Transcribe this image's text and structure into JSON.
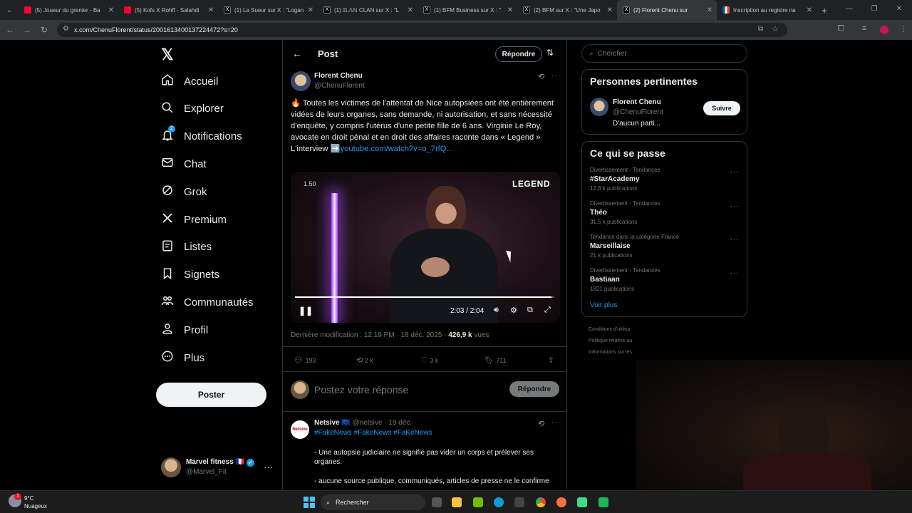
{
  "browser": {
    "tabs": [
      {
        "title": "(5) Joueur du grenier - Ba",
        "favicon": "youtube-icon"
      },
      {
        "title": "(5) Kofs X Rohff - Salahdi",
        "favicon": "youtube-icon"
      },
      {
        "title": "(1) La Sueur sur X : \"Logan",
        "favicon": "x-icon"
      },
      {
        "title": "(1) 𝕀𝕃𝔸ℕ CLAN sur X : \"L",
        "favicon": "x-icon"
      },
      {
        "title": "(1) BFM Business sur X : \"",
        "favicon": "x-icon"
      },
      {
        "title": "(2) BFM sur X : \"Une Japo",
        "favicon": "x-icon"
      },
      {
        "title": "(2) Florent Chenu sur",
        "favicon": "x-icon"
      },
      {
        "title": "Inscription au registre na",
        "favicon": "france-flag-icon"
      }
    ],
    "active_tab_index": 6,
    "url": "x.com/ChenuFlorent/status/2001613400137224472?s=20"
  },
  "nav": {
    "logo": "𝕏",
    "items": [
      {
        "label": "Accueil",
        "icon": "home-icon"
      },
      {
        "label": "Explorer",
        "icon": "search-icon"
      },
      {
        "label": "Notifications",
        "icon": "bell-icon",
        "badge": "2"
      },
      {
        "label": "Chat",
        "icon": "mail-icon"
      },
      {
        "label": "Grok",
        "icon": "grok-icon"
      },
      {
        "label": "Premium",
        "icon": "x-premium-icon"
      },
      {
        "label": "Listes",
        "icon": "list-icon"
      },
      {
        "label": "Signets",
        "icon": "bookmark-icon"
      },
      {
        "label": "Communautés",
        "icon": "communities-icon"
      },
      {
        "label": "Profil",
        "icon": "person-icon"
      },
      {
        "label": "Plus",
        "icon": "more-circle-icon"
      }
    ],
    "post_button": "Poster",
    "account": {
      "name": "Marvel fitness 🇫🇷",
      "handle": "@Marvel_Fit"
    }
  },
  "header": {
    "title": "Post",
    "reply_button": "Répondre"
  },
  "post": {
    "author": "Florent Chenu",
    "handle": "@ChenuFlorent",
    "text": "🔥 Toutes les victimes de l'attentat de Nice autopsiées ont été entièrement vidées de leurs organes, sans demande, ni autorisation, et sans nécessité d'enquête, y compris l'utérus d'une petite fille de 6 ans. Virginie Le Roy, avocate en droit pénal et en droit des affaires raconte dans « Legend »",
    "link_prefix": "L'interview ➡️",
    "link": "youtube.com/watch?v=o_7rfQ...",
    "video": {
      "watermark": "LEGEND",
      "corner_label": "1.50",
      "time": "2:03 / 2:04",
      "progress": 0.99
    },
    "meta": "Dernière modification : 12:19 PM · 18 déc. 2025 ·",
    "views_count": "426,9 k",
    "views_label": "vues",
    "stats": {
      "replies": "193",
      "reposts": "2 k",
      "likes": "3 k",
      "bookmarks": "711"
    },
    "reply_placeholder": "Postez votre réponse",
    "reply_button": "Répondre"
  },
  "reply": {
    "author": "Netsive",
    "flag": "🇪🇺",
    "handle_date": "@netsive · 19 déc.",
    "avatar_text": "Netsive",
    "hashtags": "#FakeNews #FakeNews #FaKeNews",
    "line1": "- Une autopsie judiciaire ne signifie pas vider un corps et prélever ses organes.",
    "line2": "- aucune source publique, communiqués, articles de presse ne le confirme"
  },
  "right": {
    "search_placeholder": "Chercher",
    "relevant": {
      "title": "Personnes pertinentes",
      "name": "Florent Chenu",
      "handle": "@ChenuFlorent",
      "bio": "D'aucun parti...",
      "follow": "Suivre"
    },
    "trending": {
      "title": "Ce qui se passe",
      "items": [
        {
          "context": "Divertissement · Tendances",
          "name": "#StarAcademy",
          "count": "12,8 k publications"
        },
        {
          "context": "Divertissement · Tendances",
          "name": "Théo",
          "count": "31,5 k publications"
        },
        {
          "context": "Tendance dans la catégorie France",
          "name": "Marseillaise",
          "count": "21 k publications"
        },
        {
          "context": "Divertissement · Tendances",
          "name": "Bastiaan",
          "count": "1821 publications"
        }
      ],
      "show_more": "Voir plus"
    },
    "footer": [
      "Conditions d'utilisa",
      "Politique relative au",
      "Informations sur les"
    ]
  },
  "taskbar": {
    "temp": "9°C",
    "weather": "Nuageux",
    "alert_count": "1",
    "search_placeholder": "Rechercher"
  }
}
